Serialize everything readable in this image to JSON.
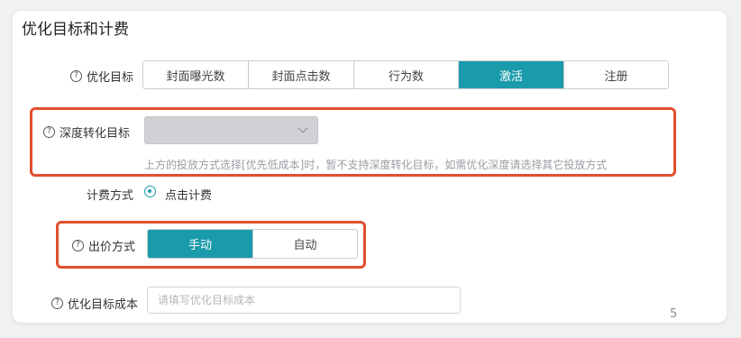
{
  "section": {
    "title": "优化目标和计费"
  },
  "optimization_goal": {
    "label": "优化目标",
    "options": [
      "封面曝光数",
      "封面点击数",
      "行为数",
      "激活",
      "注册"
    ],
    "selected": "激活"
  },
  "deep_conversion": {
    "label": "深度转化目标",
    "select_value": "",
    "hint": "上方的投放方式选择[优先低成本]时，暂不支持深度转化目标，如需优化深度请选择其它投放方式"
  },
  "billing": {
    "label": "计费方式",
    "option": "点击计费"
  },
  "bid_mode": {
    "label": "出价方式",
    "options": [
      "手动",
      "自动"
    ],
    "selected": "手动"
  },
  "target_cost": {
    "label": "优化目标成本",
    "placeholder": "请填写优化目标成本",
    "value": ""
  },
  "corner_text": "5",
  "colors": {
    "accent": "#1a9bab",
    "highlight": "#e34f2f",
    "hint": "#9a9da2"
  }
}
